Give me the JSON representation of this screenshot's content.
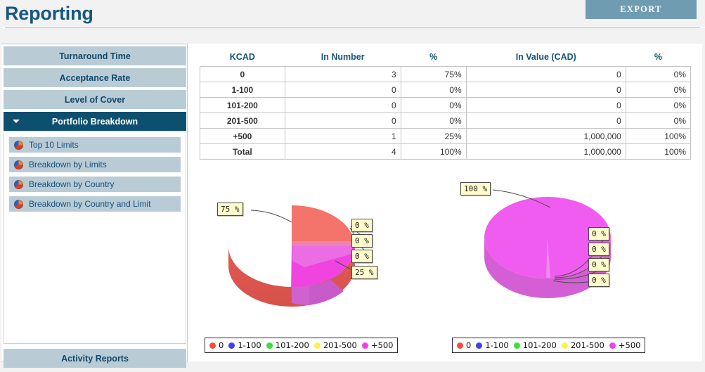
{
  "header": {
    "title": "Reporting",
    "export_label": "EXPORT"
  },
  "sidebar": {
    "items": [
      {
        "label": "Turnaround Time",
        "active": false
      },
      {
        "label": "Acceptance Rate",
        "active": false
      },
      {
        "label": "Level of Cover",
        "active": false
      },
      {
        "label": "Portfolio Breakdown",
        "active": true
      }
    ],
    "sub_items": [
      {
        "label": "Top 10 Limits",
        "icon": "pie-chart-icon"
      },
      {
        "label": "Breakdown by Limits",
        "icon": "pie-chart-icon"
      },
      {
        "label": "Breakdown by Country",
        "icon": "pie-chart-icon"
      },
      {
        "label": "Breakdown by Country and Limit",
        "icon": "pie-chart-icon"
      }
    ],
    "bottom_item": {
      "label": "Activity Reports"
    }
  },
  "table": {
    "columns": [
      "KCAD",
      "In Number",
      "%",
      "In Value (CAD)",
      "%"
    ],
    "rows": [
      {
        "category": "0",
        "in_number": "3",
        "number_pct": "75%",
        "in_value": "0",
        "value_pct": "0%"
      },
      {
        "category": "1-100",
        "in_number": "0",
        "number_pct": "0%",
        "in_value": "0",
        "value_pct": "0%"
      },
      {
        "category": "101-200",
        "in_number": "0",
        "number_pct": "0%",
        "in_value": "0",
        "value_pct": "0%"
      },
      {
        "category": "201-500",
        "in_number": "0",
        "number_pct": "0%",
        "in_value": "0",
        "value_pct": "0%"
      },
      {
        "category": "+500",
        "in_number": "1",
        "number_pct": "25%",
        "in_value": "1,000,000",
        "value_pct": "100%"
      },
      {
        "category": "Total",
        "in_number": "4",
        "number_pct": "100%",
        "in_value": "1,000,000",
        "value_pct": "100%"
      }
    ]
  },
  "legend": {
    "entries": [
      {
        "label": "0",
        "color": "#f74a42"
      },
      {
        "label": "1-100",
        "color": "#4040f0"
      },
      {
        "label": "101-200",
        "color": "#3ae03a"
      },
      {
        "label": "201-500",
        "color": "#fbf24a"
      },
      {
        "label": "+500",
        "color": "#f23ef2"
      }
    ]
  },
  "chart_data": [
    {
      "id": "chart-left",
      "type": "pie",
      "title": "In Number",
      "categories": [
        "0",
        "1-100",
        "101-200",
        "201-500",
        "+500"
      ],
      "values": [
        75,
        0,
        0,
        0,
        25
      ],
      "colors": [
        "#f74a42",
        "#4040f0",
        "#3ae03a",
        "#fbf24a",
        "#f23ef2"
      ],
      "labels": [
        "75 %",
        "0 %",
        "0 %",
        "0 %",
        "25 %"
      ],
      "legend_position": "bottom",
      "three_d": true
    },
    {
      "id": "chart-right",
      "type": "pie",
      "title": "In Value (CAD)",
      "categories": [
        "0",
        "1-100",
        "101-200",
        "201-500",
        "+500"
      ],
      "values": [
        0,
        0,
        0,
        0,
        100
      ],
      "colors": [
        "#f74a42",
        "#4040f0",
        "#3ae03a",
        "#fbf24a",
        "#f23ef2"
      ],
      "labels": [
        "0 %",
        "0 %",
        "0 %",
        "0 %",
        "100 %"
      ],
      "legend_position": "bottom",
      "three_d": true
    }
  ],
  "callouts": {
    "left": [
      "75 %",
      "0 %",
      "0 %",
      "0 %",
      "25 %"
    ],
    "right": [
      "100 %",
      "0 %",
      "0 %",
      "0 %",
      "0 %"
    ]
  }
}
